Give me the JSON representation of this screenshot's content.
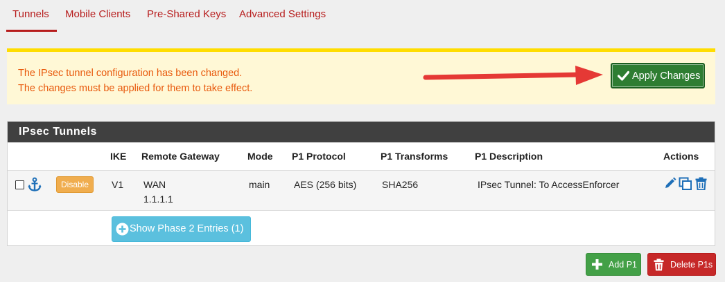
{
  "tabs": [
    {
      "label": "Tunnels",
      "active": true
    },
    {
      "label": "Mobile Clients",
      "active": false
    },
    {
      "label": "Pre-Shared Keys",
      "active": false
    },
    {
      "label": "Advanced Settings",
      "active": false
    }
  ],
  "alert": {
    "line1": "The IPsec tunnel configuration has been changed.",
    "line2": "The changes must be applied for them to take effect.",
    "apply_label": "Apply Changes"
  },
  "panel": {
    "title": "IPsec Tunnels",
    "columns": [
      "IKE",
      "Remote Gateway",
      "Mode",
      "P1 Protocol",
      "P1 Transforms",
      "P1 Description",
      "Actions"
    ],
    "rows": [
      {
        "disable_label": "Disable",
        "ike": "V1",
        "gateway_name": "WAN",
        "gateway_ip": "1.1.1.1",
        "mode": "main",
        "protocol": "AES (256 bits)",
        "transforms": "SHA256",
        "description": "IPsec Tunnel: To AccessEnforcer"
      }
    ],
    "show_phase2_label": "Show Phase 2 Entries (1)"
  },
  "footer": {
    "add_label": "Add P1",
    "delete_label": "Delete P1s"
  },
  "colors": {
    "accent": "#b71c1c",
    "alert_bg": "#fff8d6",
    "alert_border": "#ffdd00",
    "alert_text": "#e8590c",
    "apply_green": "#2e7d32",
    "info_blue": "#5bc0de",
    "warning_orange": "#f0ad4e",
    "danger_red": "#c62828",
    "action_icon_blue": "#1e6fb8"
  },
  "icons": {
    "apply": "check-icon",
    "row": "anchor-icon",
    "edit": "pencil-icon",
    "copy": "copy-icon",
    "delete": "trash-icon",
    "show": "plus-circle-icon",
    "add": "plus-icon",
    "delete_all": "trash-icon"
  }
}
